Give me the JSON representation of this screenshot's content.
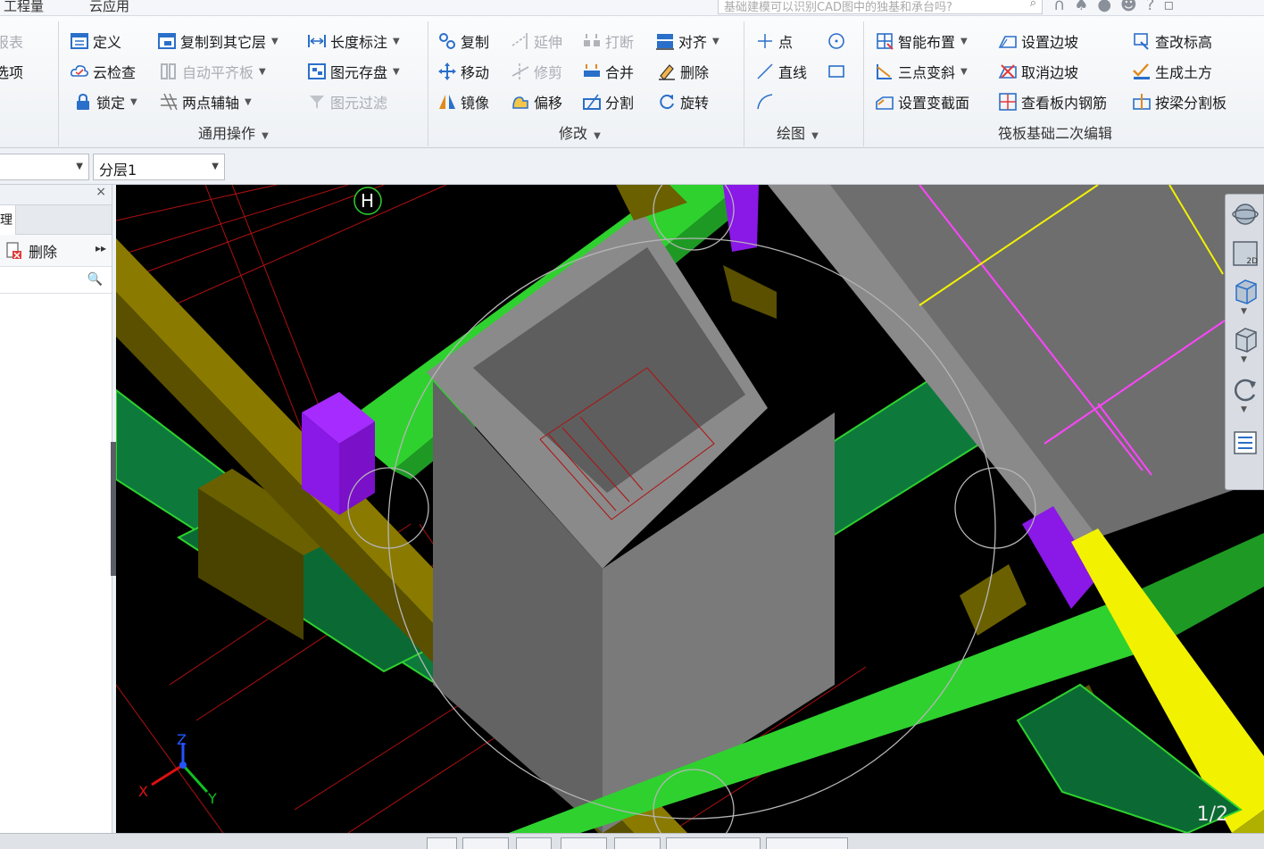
{
  "menu": {
    "tabs": [
      "工程量",
      "云应用"
    ],
    "search_placeholder": "基础建模可以识别CAD图中的独基和承台吗?"
  },
  "ribbon": {
    "left_partial": {
      "item1": "报表",
      "item2": "选项"
    },
    "general": {
      "define": "定义",
      "cloud_check": "云检查",
      "lock": "锁定",
      "copy_to_layer": "复制到其它层",
      "auto_flush": "自动平齐板",
      "two_point_axis": "两点辅轴",
      "length_mark": "长度标注",
      "save_element": "图元存盘",
      "element_filter": "图元过滤",
      "group_label": "通用操作"
    },
    "modify": {
      "copy": "复制",
      "move": "移动",
      "mirror": "镜像",
      "extend": "延伸",
      "trim": "修剪",
      "offset": "偏移",
      "break": "打断",
      "merge": "合并",
      "split": "分割",
      "align": "对齐",
      "delete": "删除",
      "rotate": "旋转",
      "group_label": "修改"
    },
    "draw": {
      "point": "点",
      "line": "直线",
      "group_label": "绘图"
    },
    "raft": {
      "smart_layout": "智能布置",
      "three_point_slope": "三点变斜",
      "set_section": "设置变截面",
      "set_slope": "设置边坡",
      "cancel_slope": "取消边坡",
      "view_rebar": "查看板内钢筋",
      "check_elev": "查改标高",
      "gen_earth": "生成土方",
      "split_by_beam": "按梁分割板",
      "group_label": "筏板基础二次编辑"
    }
  },
  "layerbar": {
    "combo1": "",
    "combo2": "分层1"
  },
  "leftpanel": {
    "tab": "理",
    "delete": "删除"
  },
  "viewport": {
    "axis_label": "H",
    "page": "1/2",
    "axes": {
      "x": "X",
      "y": "Y",
      "z": "Z"
    },
    "nav_2d": "2D"
  },
  "colors": {
    "green": "#2fd12f",
    "olive": "#6b6000",
    "gray": "#7a7a7a",
    "purple": "#8a18e6",
    "yellow": "#f2f200",
    "magenta": "#ff44ff",
    "darkgreen": "#0d7a3c"
  }
}
